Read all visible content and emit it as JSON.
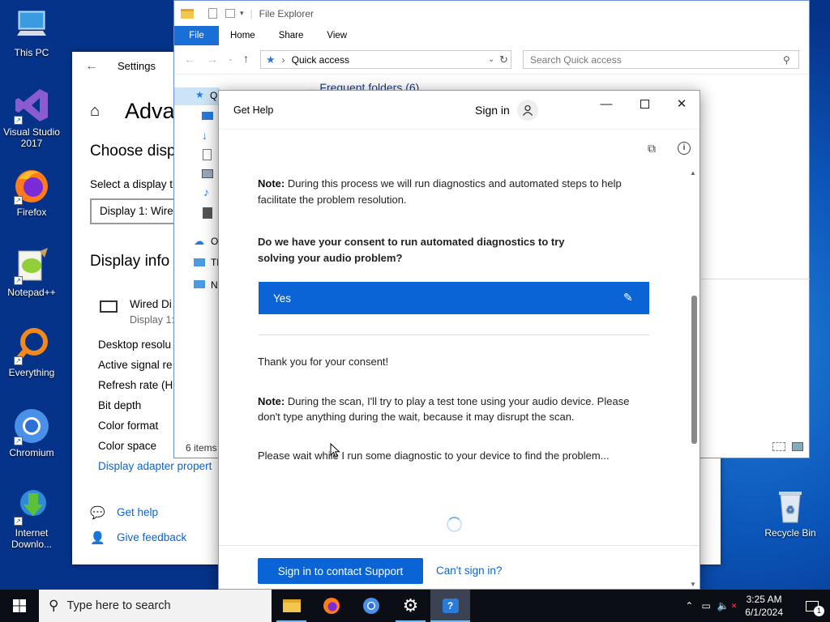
{
  "desktop": {
    "icons": [
      {
        "label": "This PC",
        "icon": "this-pc-icon"
      },
      {
        "label": "Visual Studio 2017",
        "icon": "visual-studio-icon"
      },
      {
        "label": "Firefox",
        "icon": "firefox-icon"
      },
      {
        "label": "Notepad++",
        "icon": "notepadpp-icon"
      },
      {
        "label": "Everything",
        "icon": "everything-icon"
      },
      {
        "label": "Chromium",
        "icon": "chromium-icon"
      },
      {
        "label": "Internet Downlo...",
        "icon": "idm-icon"
      },
      {
        "label": "Recycle Bin",
        "icon": "recycle-bin-icon"
      }
    ]
  },
  "settings": {
    "title": "Settings",
    "heading": "Adva",
    "choose_display": "Choose disp",
    "select_label": "Select a display t",
    "select_value": "Display 1: Wire",
    "display_info": "Display info",
    "monitor_name": "Wired Di",
    "monitor_sub": "Display 1:",
    "rows": [
      "Desktop resolu",
      "Active signal re",
      "Refresh rate (H",
      "Bit depth",
      "Color format",
      "Color space"
    ],
    "adapter_link": "Display adapter propert",
    "get_help": "Get help",
    "give_feedback": "Give feedback"
  },
  "explorer": {
    "title": "File Explorer",
    "tabs": [
      "File",
      "Home",
      "Share",
      "View"
    ],
    "address": "Quick access",
    "search_placeholder": "Search Quick access",
    "frequent": "Frequent folders (6)",
    "nav": [
      "Q",
      "",
      "",
      "",
      "",
      "",
      "",
      "O",
      "Th",
      "N"
    ],
    "status": "6 items"
  },
  "gethelp": {
    "title": "Get Help",
    "sign_in": "Sign in",
    "note1_label": "Note:",
    "note1_text": " During this process we will run diagnostics and automated steps to help facilitate the problem resolution.",
    "consent_question": "Do we have your consent to run automated diagnostics to try solving your audio problem?",
    "yes_label": "Yes",
    "thanks": "Thank you for your consent!",
    "note2_label": "Note:",
    "note2_text": " During the scan, I'll try to play a test tone using your audio device.  Please don't type anything during the wait, because it may disrupt the scan.",
    "wait_text": "Please wait while I run some diagnostic to your device to find the problem...",
    "contact_button": "Sign in to contact Support",
    "cant_sign_in": "Can't sign in?"
  },
  "taskbar": {
    "search_placeholder": "Type here to search",
    "time": "3:25 AM",
    "date": "6/1/2024",
    "notification_count": "1"
  },
  "colors": {
    "accent": "#0a64d6",
    "taskbar": "#0b0e14"
  }
}
